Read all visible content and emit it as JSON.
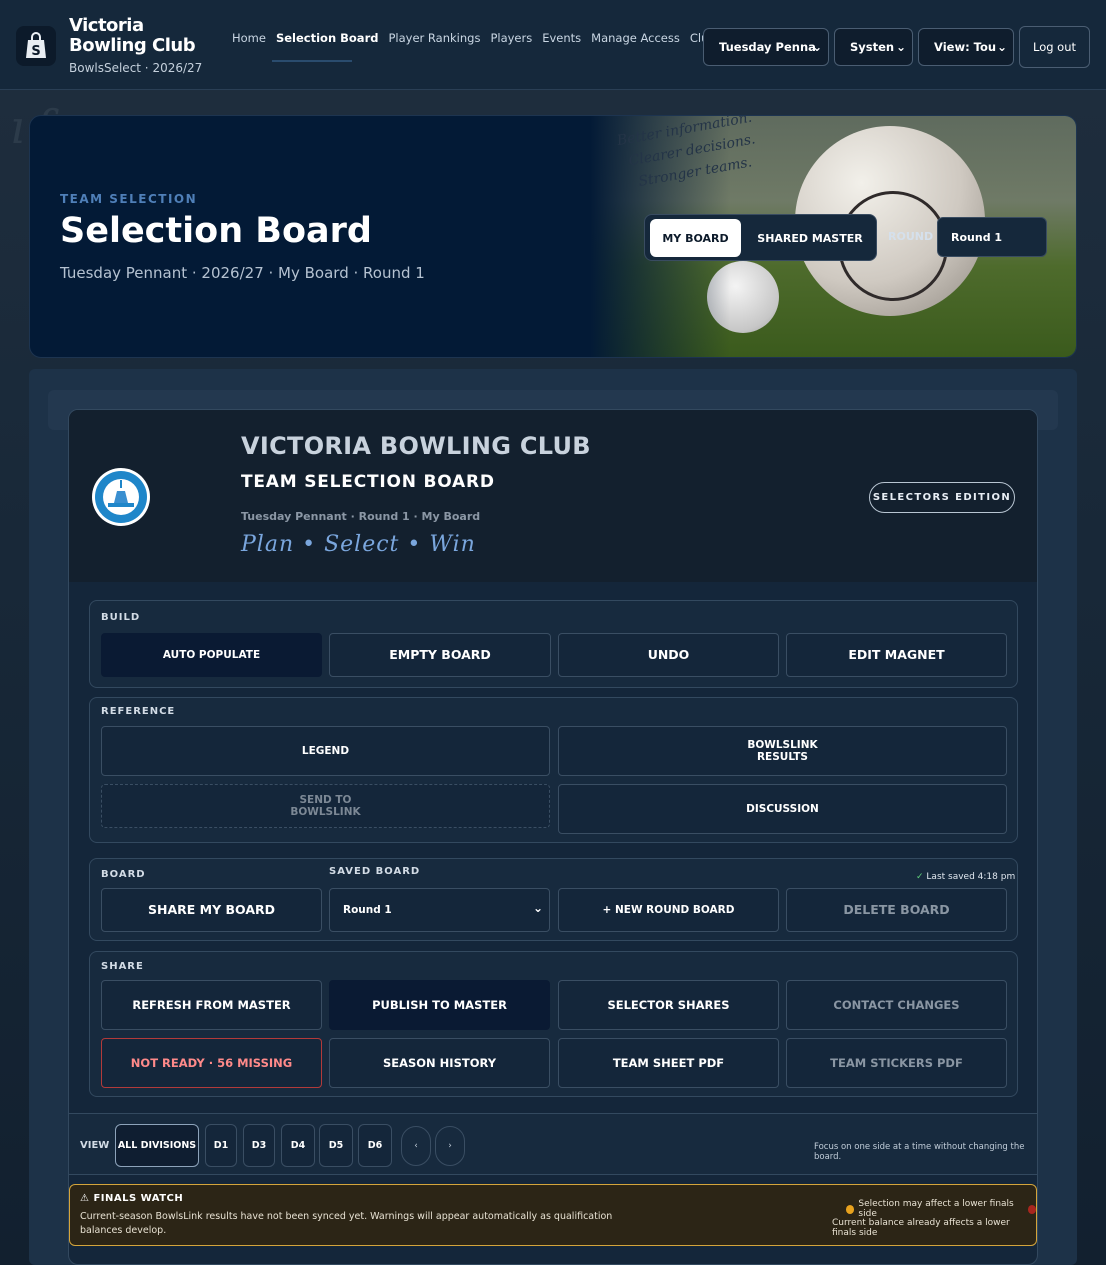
{
  "brand": {
    "title": "Victoria Bowling Club",
    "subtitle": "BowlsSelect · 2026/27"
  },
  "nav": {
    "links": [
      "Home",
      "Selection Board",
      "Player Rankings",
      "Players",
      "Events",
      "Manage Access",
      "Club Setup"
    ],
    "active": "Selection Board",
    "selects": {
      "event": "Tuesday Penna",
      "system": "Systen",
      "view": "View: Tou"
    },
    "logout": "Log out"
  },
  "hero": {
    "eyebrow": "TEAM SELECTION",
    "title": "Selection Board",
    "subtitle": "Tuesday Pennant · 2026/27 · My Board · Round 1",
    "tagline": [
      "Better information.",
      "Clearer decisions.",
      "Stronger teams."
    ],
    "toggle": {
      "my": "MY BOARD",
      "shared": "SHARED MASTER"
    },
    "round_label": "ROUND",
    "round_value": "Round 1"
  },
  "board": {
    "club": "VICTORIA BOWLING CLUB",
    "title": "TEAM SELECTION BOARD",
    "meta": "Tuesday Pennant · Round 1 · My Board",
    "motto": "Plan • Select • Win",
    "edition": "SELECTORS EDITION"
  },
  "build": {
    "label": "BUILD",
    "buttons": [
      "AUTO POPULATE",
      "EMPTY BOARD",
      "UNDO",
      "EDIT MAGNET"
    ]
  },
  "reference": {
    "label": "REFERENCE",
    "legend": "LEGEND",
    "results": "BOWLSLINK\nRESULTS",
    "send": "SEND TO\nBOWLSLINK",
    "discussion": "DISCUSSION"
  },
  "boardgroup": {
    "label": "BOARD",
    "saved_label": "SAVED BOARD",
    "last_saved": "Last saved 4:18 pm",
    "share": "SHARE MY BOARD",
    "saved_value": "Round 1",
    "new_round": "+ NEW ROUND BOARD",
    "delete": "DELETE BOARD"
  },
  "share": {
    "label": "SHARE",
    "refresh": "REFRESH FROM MASTER",
    "publish": "PUBLISH TO MASTER",
    "selector_shares": "SELECTOR SHARES",
    "contact_changes": "CONTACT CHANGES",
    "not_ready": "NOT READY · 56 MISSING",
    "season_history": "SEASON HISTORY",
    "team_sheet": "TEAM SHEET PDF",
    "stickers": "TEAM STICKERS PDF"
  },
  "view": {
    "label": "VIEW",
    "divisions": [
      "ALL DIVISIONS",
      "D1",
      "D3",
      "D4",
      "D5",
      "D6"
    ],
    "prev": "‹",
    "next": "›",
    "note": "Focus on one side at a time without changing the board."
  },
  "finals": {
    "title": "FINALS WATCH",
    "text": "Current-season BowlsLink results have not been synced yet. Warnings will appear automatically as qualification balances develop.",
    "key1": "Selection may affect a lower finals side",
    "key2": "Current balance already affects a lower finals side",
    "key1_color": "#e8a21e",
    "key2_color": "#a8261e"
  },
  "colors": {
    "accent": "#0a1a33",
    "danger": "#b23a3a",
    "hero_bg": "#031a36"
  }
}
